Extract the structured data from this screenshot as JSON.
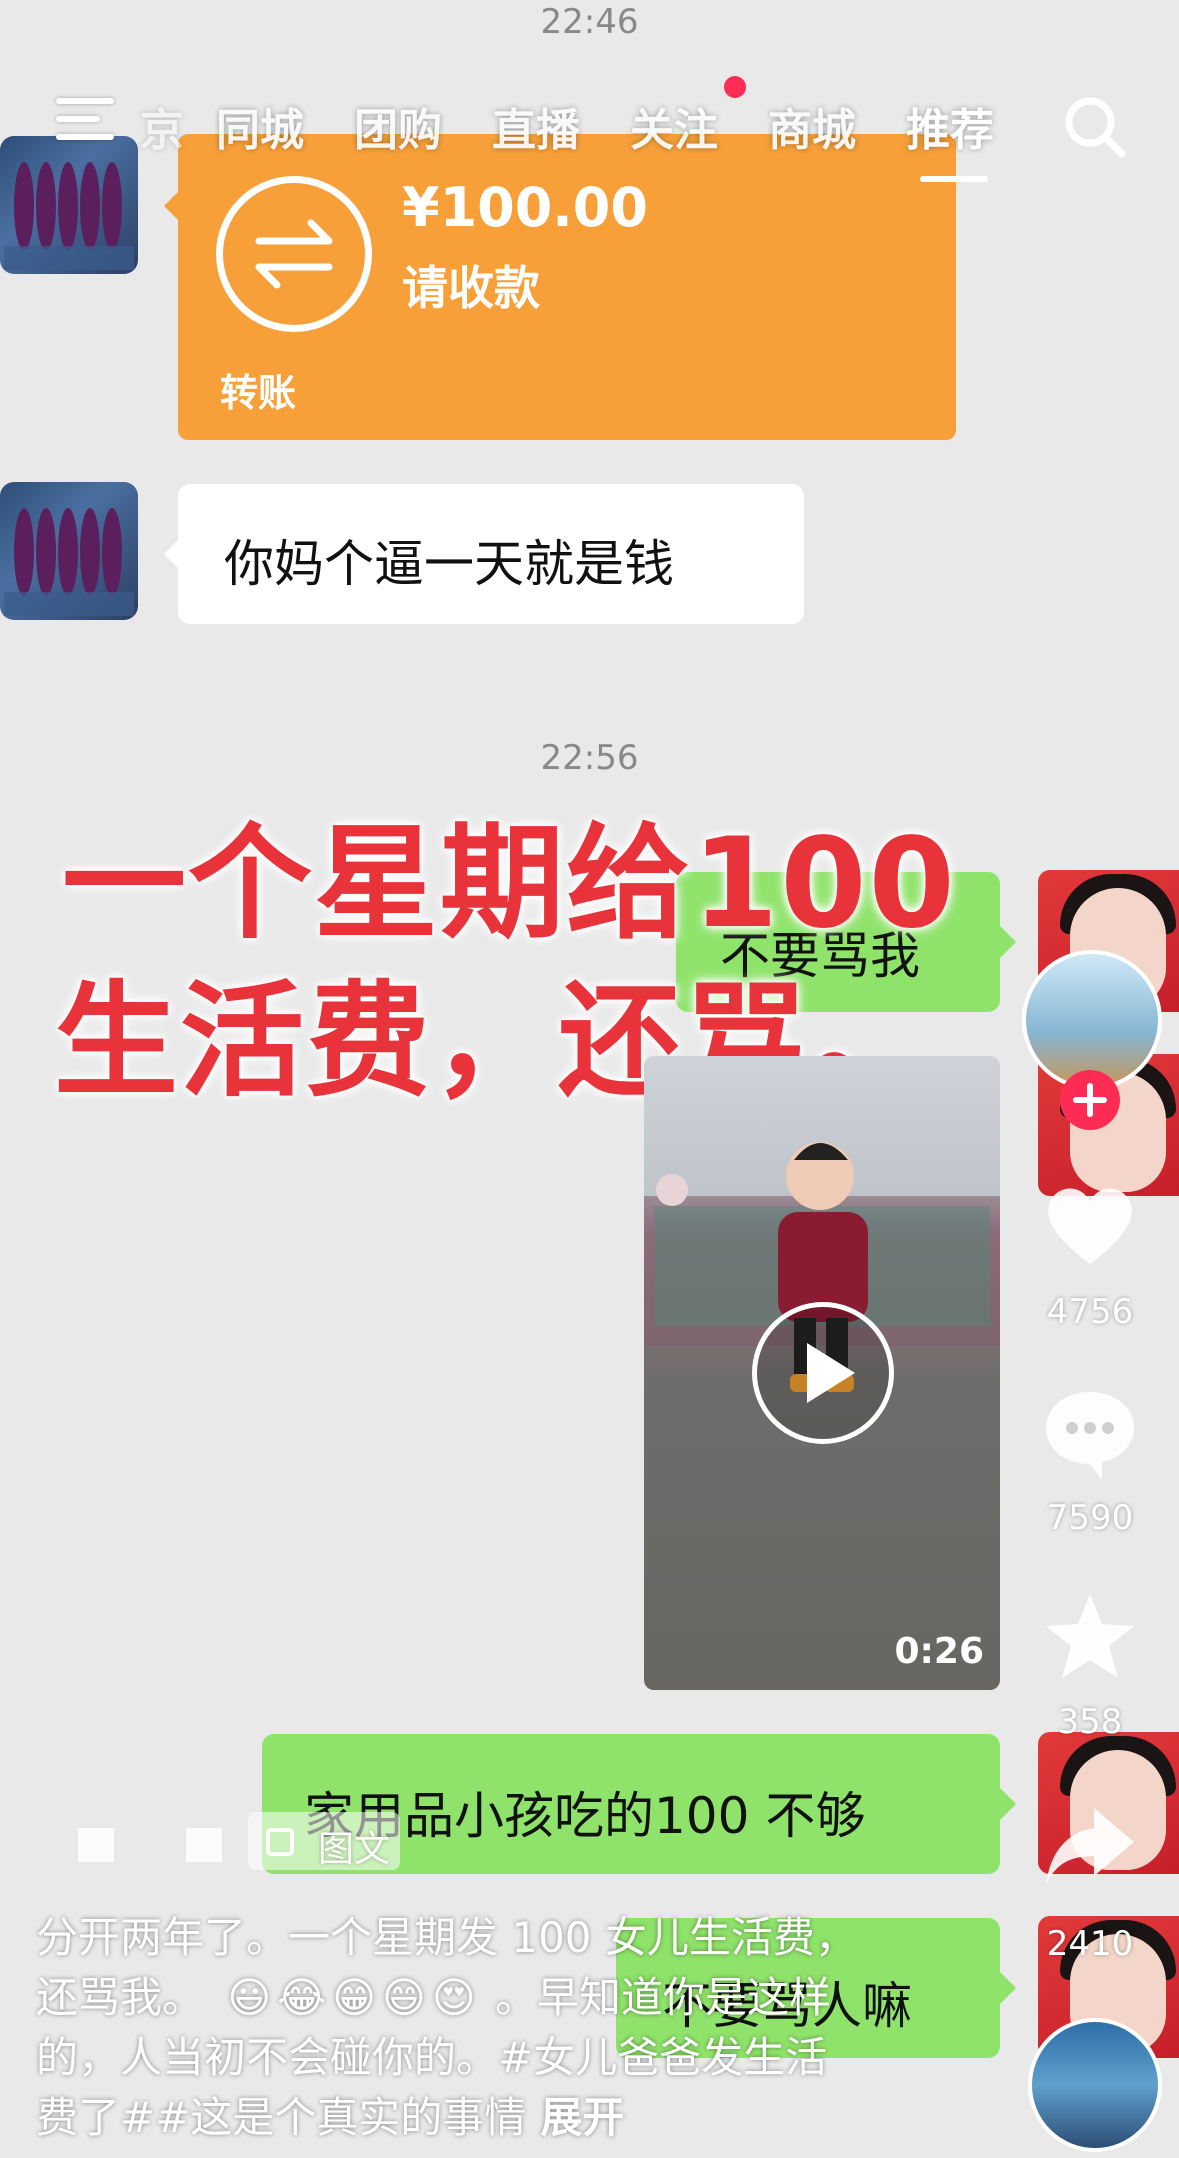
{
  "status": {
    "time_top": "22:46",
    "time_mid": "22:56"
  },
  "nav": {
    "tabs": [
      {
        "label": "京"
      },
      {
        "label": "同城"
      },
      {
        "label": "团购"
      },
      {
        "label": "直播"
      },
      {
        "label": "关注"
      },
      {
        "label": "商城"
      },
      {
        "label": "推荐",
        "active": true
      }
    ],
    "menu_icon": "menu-icon",
    "search_icon": "search-icon"
  },
  "chat": {
    "transfer": {
      "amount": "¥100.00",
      "subtitle": "请收款",
      "label": "转账",
      "icon": "transfer-arrows-icon",
      "color": "#f7a03a"
    },
    "message_1": "你妈个逼一天就是钱",
    "message_2": "不要骂我",
    "message_3": "家用品小孩吃的100 不够",
    "message_4": "不要骂人嘛",
    "bubble_green_color": "#8fe36a"
  },
  "overlay": {
    "line_1": "一个星期给100",
    "line_2": "生活费，还骂。",
    "color": "#e8333a"
  },
  "video": {
    "duration": "0:26",
    "icon": "play-icon"
  },
  "actions": {
    "likes": "4756",
    "comments": "7590",
    "favorites": "358",
    "shares": "2410",
    "follow_icon": "plus-icon"
  },
  "post": {
    "type_tag": "图文",
    "caption_line_1": "分开两年了。一个星期发 100 女儿生活费，",
    "caption_line_2_a": "还骂我。",
    "caption_line_2_b": "。早知道你是这样",
    "caption_line_3": "的，人当初不会碰你的。#女儿爸爸发生活",
    "caption_line_4": "费了##这是个真实的事情",
    "expand": "展开",
    "emojis": [
      "😃",
      "😂",
      "😁",
      "😄",
      "😍"
    ]
  }
}
